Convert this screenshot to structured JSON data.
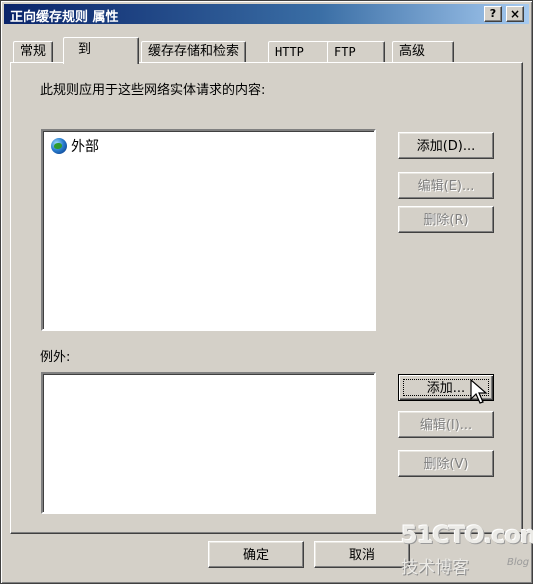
{
  "window": {
    "title": "正向缓存规则 属性",
    "help_glyph": "?",
    "close_glyph": "×"
  },
  "tabs": [
    {
      "label": "常规"
    },
    {
      "label": "到",
      "active": true
    },
    {
      "label": "缓存存储和检索"
    },
    {
      "label": "HTTP"
    },
    {
      "label": "FTP"
    },
    {
      "label": "高级"
    }
  ],
  "to_section": {
    "label": "此规则应用于这些网络实体请求的内容:",
    "items": [
      {
        "icon": "globe-icon",
        "label": "外部"
      }
    ],
    "add_label": "添加(D)...",
    "edit_label": "编辑(E)...",
    "remove_label": "删除(R)"
  },
  "exceptions_section": {
    "label": "例外:",
    "add_label": "添加...",
    "edit_label": "编辑(I)...",
    "remove_label": "删除(V)"
  },
  "footer": {
    "ok_label": "确定",
    "cancel_label": "取消"
  },
  "watermark": {
    "site": "51CTO.com",
    "tagline": "技术博客",
    "blog": "Blog"
  }
}
